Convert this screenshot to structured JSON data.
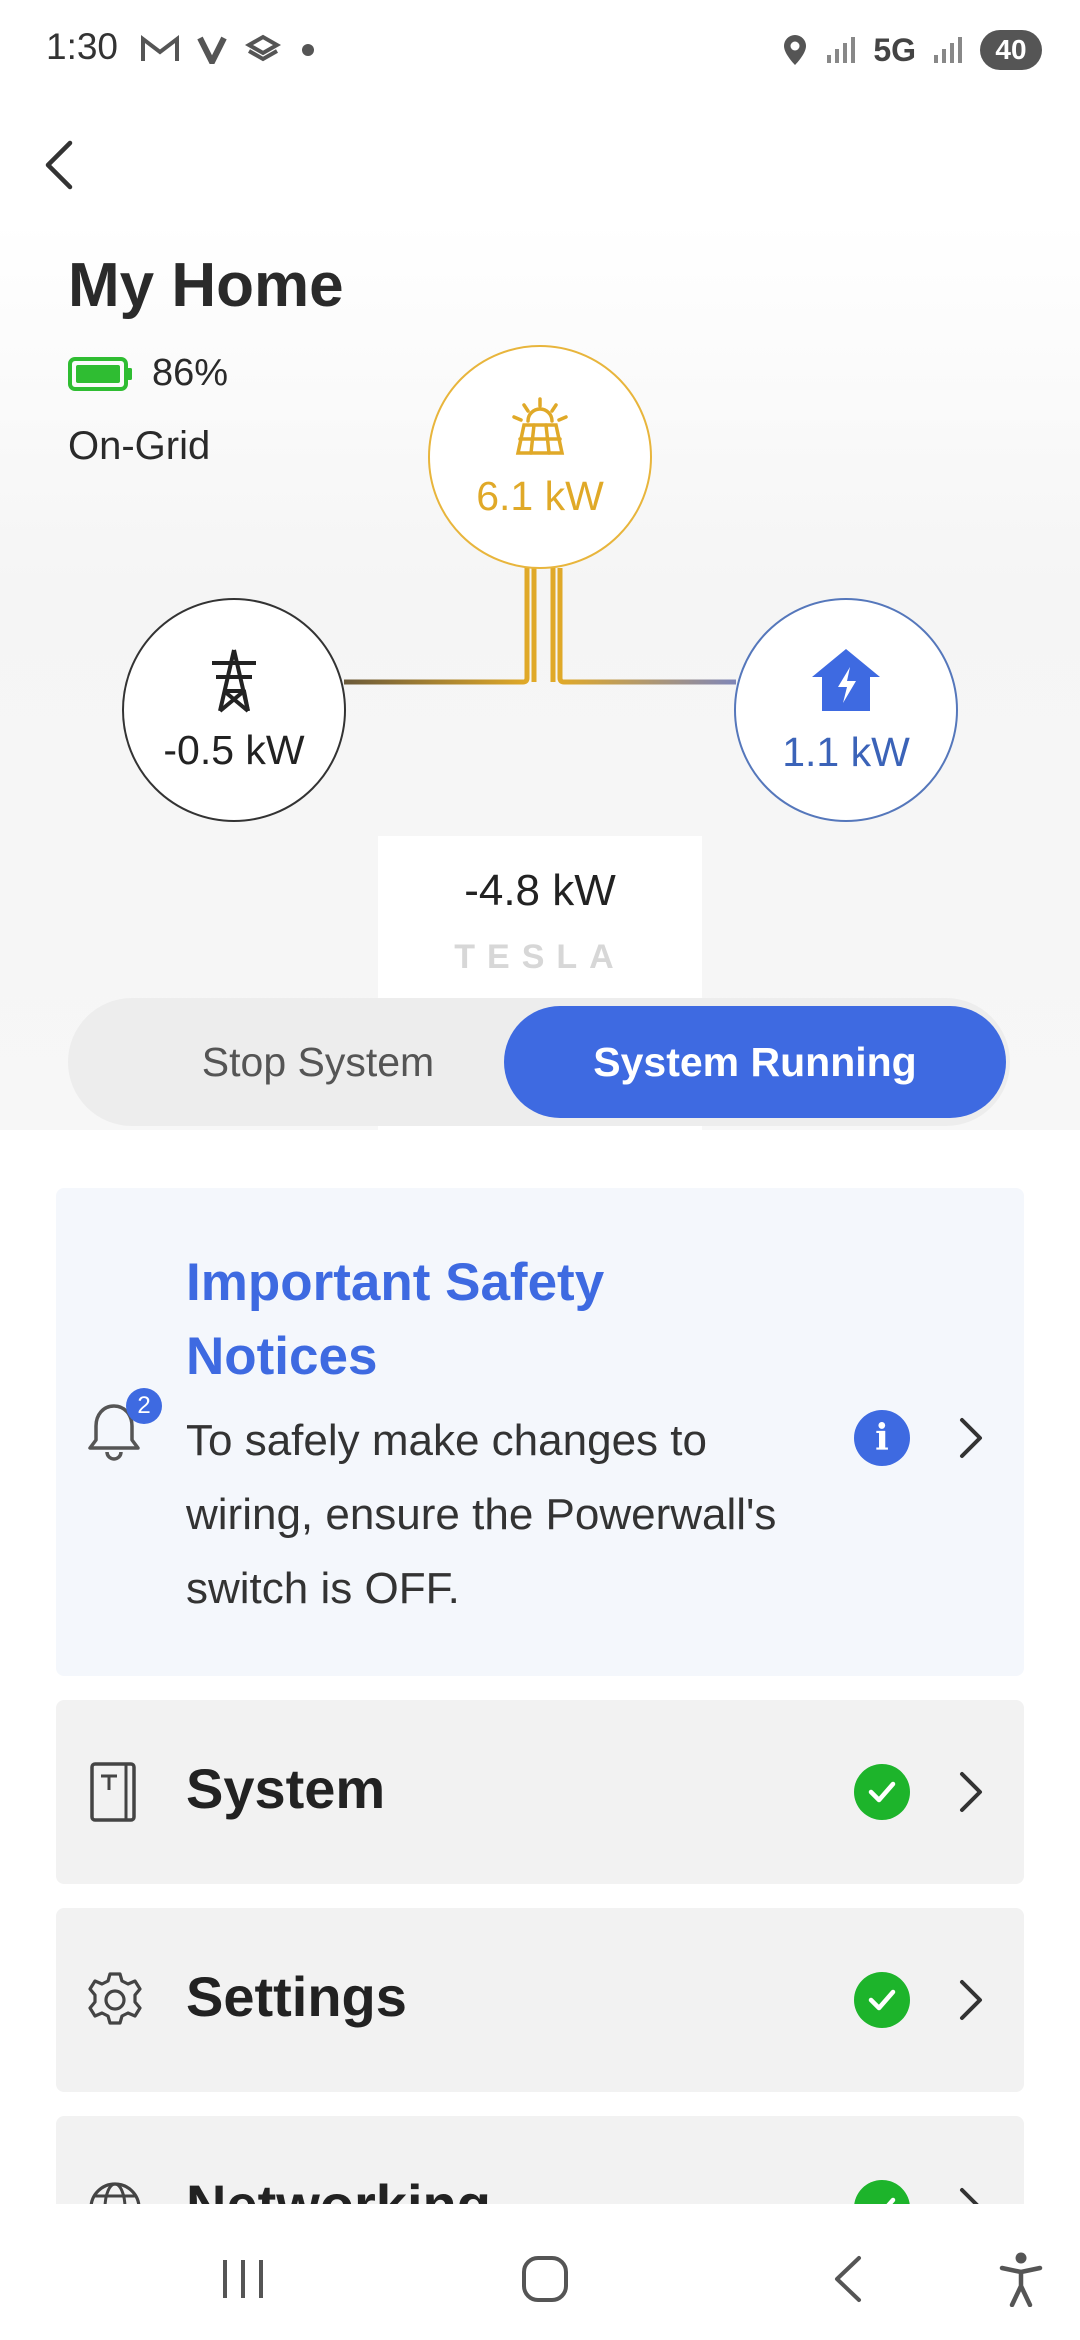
{
  "status_bar": {
    "time": "1:30",
    "left_icons": [
      "gmail-icon",
      "verizon-icon",
      "app-icon",
      "dot-icon"
    ],
    "network": "5G",
    "battery_level": "40"
  },
  "header": {
    "site_name": "My Home",
    "battery_percent": "86%",
    "grid_status": "On-Grid"
  },
  "flow": {
    "solar": {
      "icon": "solar-panel-icon",
      "value": "6.1 kW",
      "color": "#e0a928"
    },
    "grid": {
      "icon": "power-tower-icon",
      "value": "-0.5 kW",
      "color": "#222222"
    },
    "home": {
      "icon": "house-bolt-icon",
      "value": "1.1 kW",
      "color": "#3b63b8"
    },
    "powerwall": {
      "value": "-4.8 kW",
      "brand": "TESLA"
    }
  },
  "system_toggle": {
    "stop_label": "Stop System",
    "running_label": "System Running",
    "active": "running",
    "accent": "#3e6ae1"
  },
  "safety_notice": {
    "badge_count": "2",
    "title": "Important Safety Notices",
    "body": "To safely make changes to wiring, ensure the Powerwall's switch is OFF.",
    "info_glyph": "i"
  },
  "menu": [
    {
      "label": "System",
      "icon": "powerwall-icon",
      "status": "ok"
    },
    {
      "label": "Settings",
      "icon": "gear-icon",
      "status": "ok"
    },
    {
      "label": "Networking",
      "icon": "globe-icon",
      "status": "ok"
    }
  ],
  "colors": {
    "ok_green": "#1db42b",
    "battery_green": "#2fbd32"
  }
}
